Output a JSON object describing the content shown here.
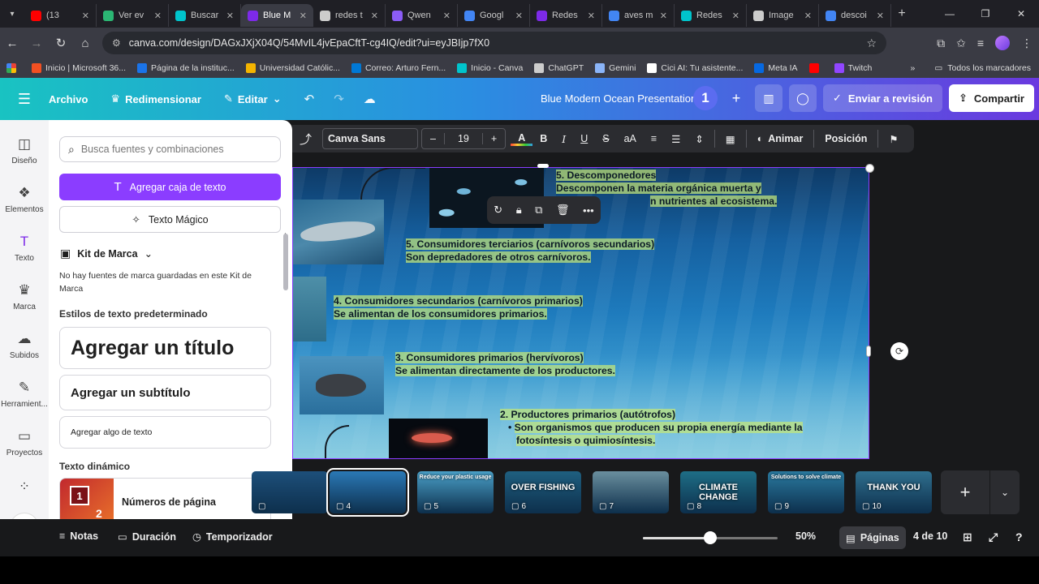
{
  "browser": {
    "tabs": [
      {
        "label": "(13",
        "color": "#ff0000"
      },
      {
        "label": "Ver ev",
        "color": "#2bb673"
      },
      {
        "label": "Buscar",
        "color": "#00c4cc"
      },
      {
        "label": "Blue M",
        "color": "#7d2ae8"
      },
      {
        "label": "redes t",
        "color": "#cccccc"
      },
      {
        "label": "Qwen",
        "color": "#8b5cf6"
      },
      {
        "label": "Googl",
        "color": "#4285f4"
      },
      {
        "label": "Redes",
        "color": "#7d2ae8"
      },
      {
        "label": "aves m",
        "color": "#4285f4"
      },
      {
        "label": "Redes",
        "color": "#00c4cc"
      },
      {
        "label": "Image",
        "color": "#cccccc"
      },
      {
        "label": "descoi",
        "color": "#4285f4"
      }
    ],
    "active_tab": 3,
    "url": "canva.com/design/DAGxJXjX04Q/54MvIL4jvEpaCftT-cg4IQ/edit?ui=eyJBIjp7fX0",
    "bookmarks": [
      {
        "label": "Inicio | Microsoft 36...",
        "color": "#f25022"
      },
      {
        "label": "Página de la instituc...",
        "color": "#1a73e8"
      },
      {
        "label": "Universidad Católic...",
        "color": "#f4b400"
      },
      {
        "label": "Correo: Arturo Fern...",
        "color": "#0078d4"
      },
      {
        "label": "Inicio - Canva",
        "color": "#00c4cc"
      },
      {
        "label": "ChatGPT",
        "color": "#cccccc"
      },
      {
        "label": "Gemini",
        "color": "#8ab4f8"
      },
      {
        "label": "Cici AI: Tu asistente...",
        "color": "#ffffff"
      },
      {
        "label": "Meta IA",
        "color": "#0668e1"
      },
      {
        "label": "",
        "color": "#ff0000"
      },
      {
        "label": "Twitch",
        "color": "#9146ff"
      }
    ],
    "all_bookmarks": "Todos los marcadores"
  },
  "header": {
    "archivo": "Archivo",
    "redimensionar": "Redimensionar",
    "editar": "Editar",
    "title": "Blue Modern Ocean Presentation",
    "avatar": "1",
    "review": "Enviar a revisión",
    "share": "Compartir"
  },
  "rail": [
    {
      "label": "Diseño",
      "icon": "layout-icon"
    },
    {
      "label": "Elementos",
      "icon": "shapes-icon"
    },
    {
      "label": "Texto",
      "icon": "text-icon"
    },
    {
      "label": "Marca",
      "icon": "brand-icon"
    },
    {
      "label": "Subidos",
      "icon": "upload-icon"
    },
    {
      "label": "Herramient...",
      "icon": "tools-icon"
    },
    {
      "label": "Proyectos",
      "icon": "folder-icon"
    }
  ],
  "panel": {
    "search_placeholder": "Busca fuentes y combinaciones",
    "add_textbox": "Agregar caja de texto",
    "magic_text": "Texto Mágico",
    "brand_kit": "Kit de Marca",
    "brand_kit_desc": "No hay fuentes de marca guardadas en este Kit de Marca",
    "default_styles": "Estilos de texto predeterminado",
    "add_title": "Agregar un título",
    "add_subtitle": "Agregar un subtítulo",
    "add_body": "Agregar algo de texto",
    "dynamic_text": "Texto dinámico",
    "page_numbers": "Números de página"
  },
  "toolbar": {
    "font": "Canva Sans",
    "minus": "–",
    "size": "19",
    "plus": "+",
    "bold": "B",
    "italic": "I",
    "underline": "U",
    "strike": "S",
    "case": "aA",
    "animate": "Animar",
    "position": "Posición"
  },
  "slide": {
    "d_title": "5. Descomponedores",
    "d_line1": "Descomponen la materia orgánica muerta y",
    "d_line2": "n nutrientes al ecosistema.",
    "t_title": "5. Consumidores terciarios (carnívoros secundarios)",
    "t_line": "Son depredadores de otros carnívoros.",
    "s_title": "4. Consumidores secundarios (carnívoros primarios)",
    "s_line": "Se alimentan de los consumidores primarios.",
    "p_title": "3. Consumidores primarios (hervívoros)",
    "p_line": "Se alimentan directamente de los productores.",
    "pr_title": "2. Productores primarios (autótrofos)",
    "pr_line1": "Son organismos que producen su propia energía mediante la",
    "pr_line2": "fotosíntesis o quimiosíntesis.",
    "bullet": "•"
  },
  "thumbnails": [
    {
      "num": "",
      "bg": "#1d4f7a",
      "text": ""
    },
    {
      "num": "4",
      "bg": "#2a78b5",
      "text": ""
    },
    {
      "num": "5",
      "bg": "#4aa0c8",
      "text": "Reduce your plastic usage"
    },
    {
      "num": "6",
      "bg": "#1f5f80",
      "text": "OVER FISHING"
    },
    {
      "num": "7",
      "bg": "#6a8f9e",
      "text": ""
    },
    {
      "num": "8",
      "bg": "#1e6e86",
      "text": "CLIMATE CHANGE"
    },
    {
      "num": "9",
      "bg": "#2a7aa0",
      "text": "Solutions to solve climate"
    },
    {
      "num": "10",
      "bg": "#2f6f8e",
      "text": "THANK YOU"
    }
  ],
  "footer": {
    "notes": "Notas",
    "duration": "Duración",
    "timer": "Temporizador",
    "zoom": "50%",
    "zoom_level": 0.5,
    "pages": "Páginas",
    "page_of": "4 de 10"
  }
}
